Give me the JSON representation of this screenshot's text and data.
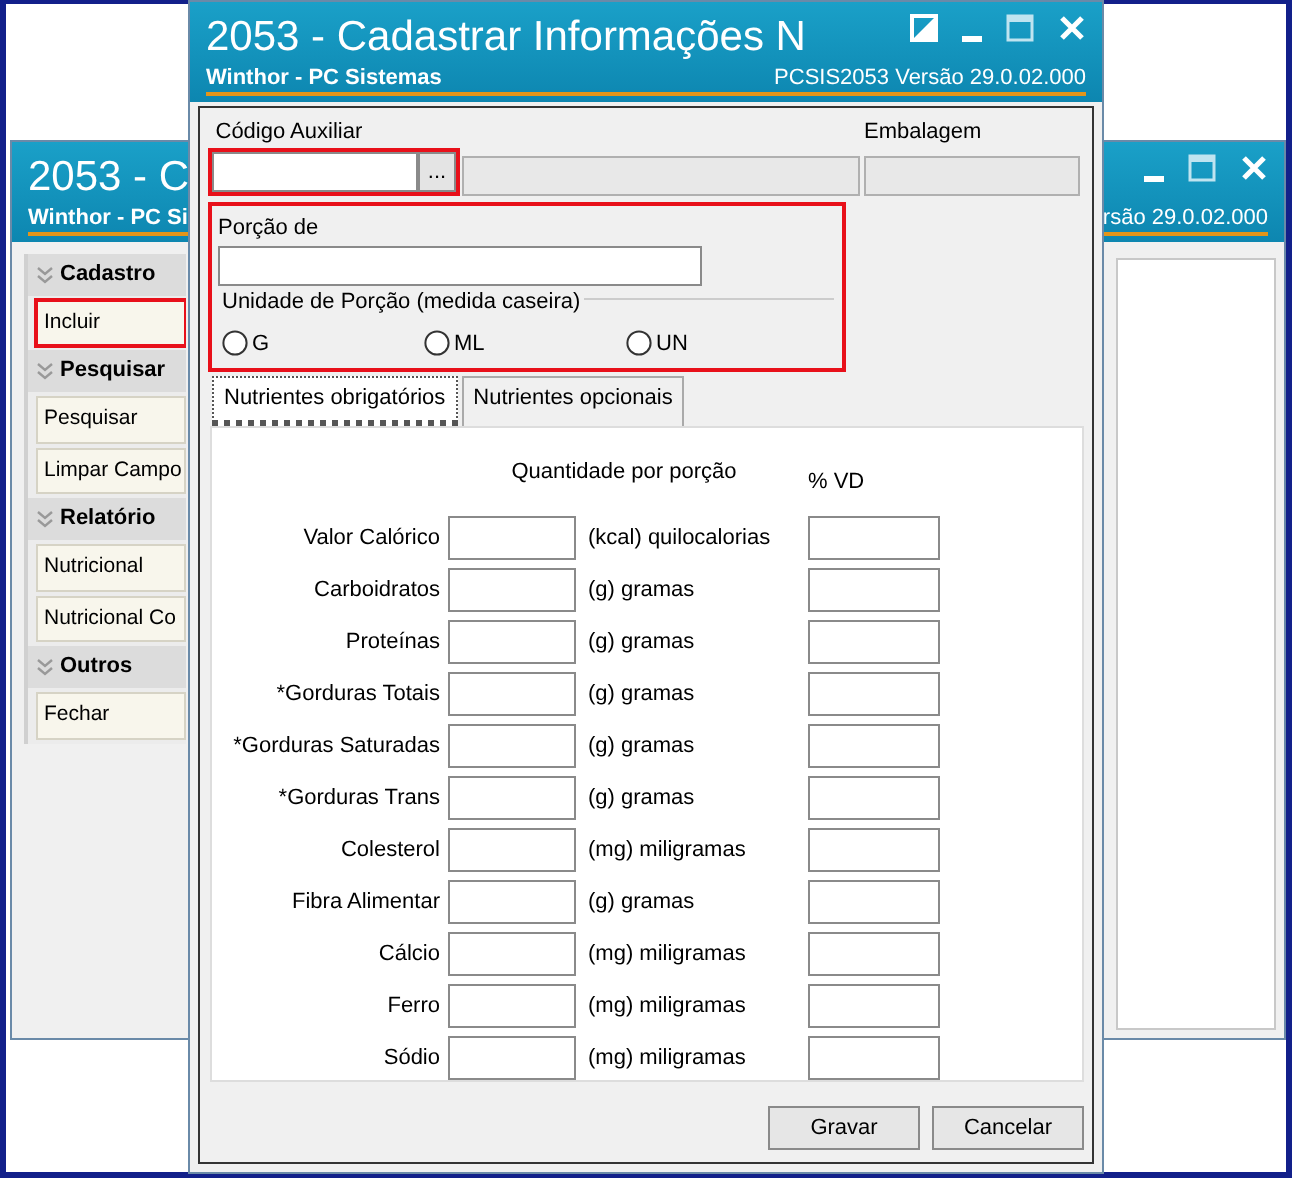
{
  "back_window": {
    "title": "2053 - C",
    "subtitle": "Winthor - PC Si",
    "version": "rsão  29.0.02.000",
    "sidebar": [
      {
        "heading": "Cadastro",
        "items": [
          {
            "label": "Incluir",
            "highlighted": true
          }
        ]
      },
      {
        "heading": "Pesquisar",
        "items": [
          {
            "label": "Pesquisar",
            "highlighted": false
          },
          {
            "label": "Limpar Campo",
            "highlighted": false
          }
        ]
      },
      {
        "heading": "Relatório",
        "items": [
          {
            "label": "Nutricional",
            "highlighted": false
          },
          {
            "label": "Nutricional Co",
            "highlighted": false
          }
        ]
      },
      {
        "heading": "Outros",
        "items": [
          {
            "label": "Fechar",
            "highlighted": false
          }
        ]
      }
    ]
  },
  "window": {
    "title": "2053 - Cadastrar Informações N",
    "subtitle": "Winthor - PC Sistemas",
    "version": "PCSIS2053  Versão  29.0.02.000"
  },
  "codigo": {
    "label": "Código Auxiliar",
    "browse": "...",
    "highlighted": true
  },
  "embalagem": {
    "label": "Embalagem"
  },
  "porcao": {
    "label": "Porção de",
    "highlighted": true,
    "unit_group": "Unidade de Porção (medida caseira)",
    "units": [
      {
        "label": "G",
        "selected": false
      },
      {
        "label": "ML",
        "selected": false
      },
      {
        "label": "UN",
        "selected": false
      }
    ]
  },
  "tabs": [
    {
      "label": "Nutrientes obrigatórios",
      "selected": true
    },
    {
      "label": "Nutrientes opcionais",
      "selected": false
    }
  ],
  "columns": {
    "quantity": "Quantidade por porção",
    "vd": "% VD"
  },
  "nutrients": [
    {
      "name": "Valor Calórico",
      "unit": "(kcal) quilocalorias"
    },
    {
      "name": "Carboidratos",
      "unit": "(g) gramas"
    },
    {
      "name": "Proteínas",
      "unit": "(g) gramas"
    },
    {
      "name": "*Gorduras Totais",
      "unit": "(g) gramas"
    },
    {
      "name": "*Gorduras Saturadas",
      "unit": "(g) gramas"
    },
    {
      "name": "*Gorduras Trans",
      "unit": "(g) gramas"
    },
    {
      "name": "Colesterol",
      "unit": "(mg) miligramas"
    },
    {
      "name": "Fibra Alimentar",
      "unit": "(g) gramas"
    },
    {
      "name": "Cálcio",
      "unit": "(mg) miligramas"
    },
    {
      "name": "Ferro",
      "unit": "(mg) miligramas"
    },
    {
      "name": "Sódio",
      "unit": "(mg) miligramas"
    }
  ],
  "buttons": [
    "Gravar",
    "Cancelar"
  ]
}
